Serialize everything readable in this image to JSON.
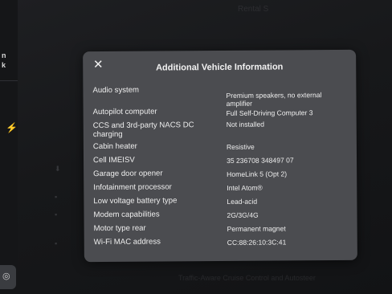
{
  "modal": {
    "title": "Additional Vehicle Information",
    "close_icon": "✕",
    "rows": [
      {
        "label": "Audio system",
        "value": "Premium speakers, no external amplifier"
      },
      {
        "label": "Autopilot computer",
        "value": "Full Self-Driving Computer 3"
      },
      {
        "label": "CCS and 3rd-party NACS DC charging",
        "value": "Not installed"
      },
      {
        "label": "Cabin heater",
        "value": "Resistive"
      },
      {
        "label": "Cell IMEISV",
        "value": "35 236708 348497 07"
      },
      {
        "label": "Garage door opener",
        "value": "HomeLink 5 (Opt 2)"
      },
      {
        "label": "Infotainment processor",
        "value": "Intel Atom®"
      },
      {
        "label": "Low voltage battery type",
        "value": "Lead-acid"
      },
      {
        "label": "Modem capabilities",
        "value": "2G/3G/4G"
      },
      {
        "label": "Motor type rear",
        "value": "Permanent magnet"
      },
      {
        "label": "Wi-Fi MAC address",
        "value": "CC:88:26:10:3C:41"
      }
    ]
  },
  "background": {
    "rail_text_1": "n",
    "rail_text_2": "k",
    "bolt_icon": "⚡",
    "bottom_icon": "◎",
    "top_faint": "Rental S",
    "bottom_faint": "Traffic-Aware Cruise Control and Autosteer"
  }
}
